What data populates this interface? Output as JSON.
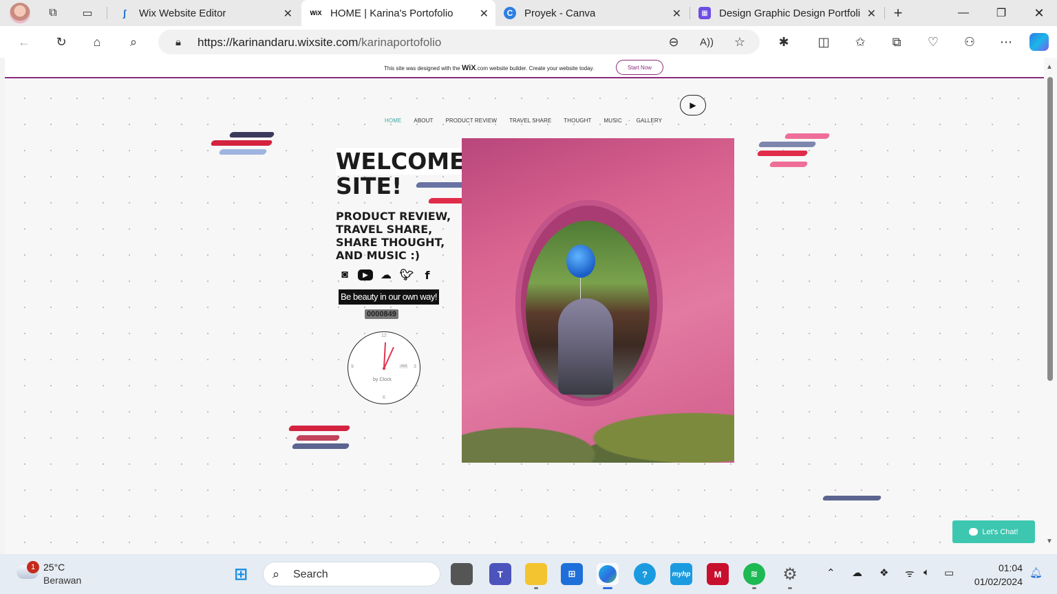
{
  "browser": {
    "tabs": [
      {
        "title": "Wix Website Editor",
        "active": false
      },
      {
        "title": "HOME | Karina's Portofolio",
        "active": true,
        "favicon_text": "WiX"
      },
      {
        "title": "Proyek - Canva",
        "active": false
      },
      {
        "title": "Design Graphic Design Portfolio",
        "active": false
      }
    ],
    "url_host": "https://karinandaru.wixsite.com",
    "url_path": "/karinaportofolio"
  },
  "wix_banner": {
    "message_before": "This site was designed with the",
    "brand": "WiX",
    "message_after": ".com website builder. Create your website today.",
    "cta": "Start Now"
  },
  "site": {
    "nav": [
      "HOME",
      "ABOUT",
      "PRODUCT REVIEW",
      "TRAVEL SHARE",
      "THOUGHT",
      "MUSIC",
      "GALLERY"
    ],
    "headline_line1": "WELCOME TO MY",
    "headline_line2": "SITE!",
    "subtitle": "PRODUCT REVIEW, TRAVEL SHARE, SHARE THOUGHT, AND MUSIC :)",
    "socials": [
      "instagram-icon",
      "youtube-icon",
      "soundcloud-icon",
      "twitter-icon",
      "facebook-icon"
    ],
    "motto": "Be beauty in our own way!",
    "visitor_count": "0000849",
    "clock": {
      "n12": "12",
      "n3": "3",
      "n6": "6",
      "n9": "9",
      "ampm": "AM",
      "credit": "by Clock"
    },
    "chat_label": "Let's Chat!"
  },
  "taskbar": {
    "weather_temp": "25°C",
    "weather_cond": "Berawan",
    "weather_badge": "1",
    "search_placeholder": "Search",
    "time": "01:04",
    "date": "01/02/2024"
  },
  "colors": {
    "wix_accent": "#8a2a7a",
    "nav_active": "#3aa7a0",
    "chat": "#3ec7b0",
    "photo_pink": "#d9638f"
  }
}
